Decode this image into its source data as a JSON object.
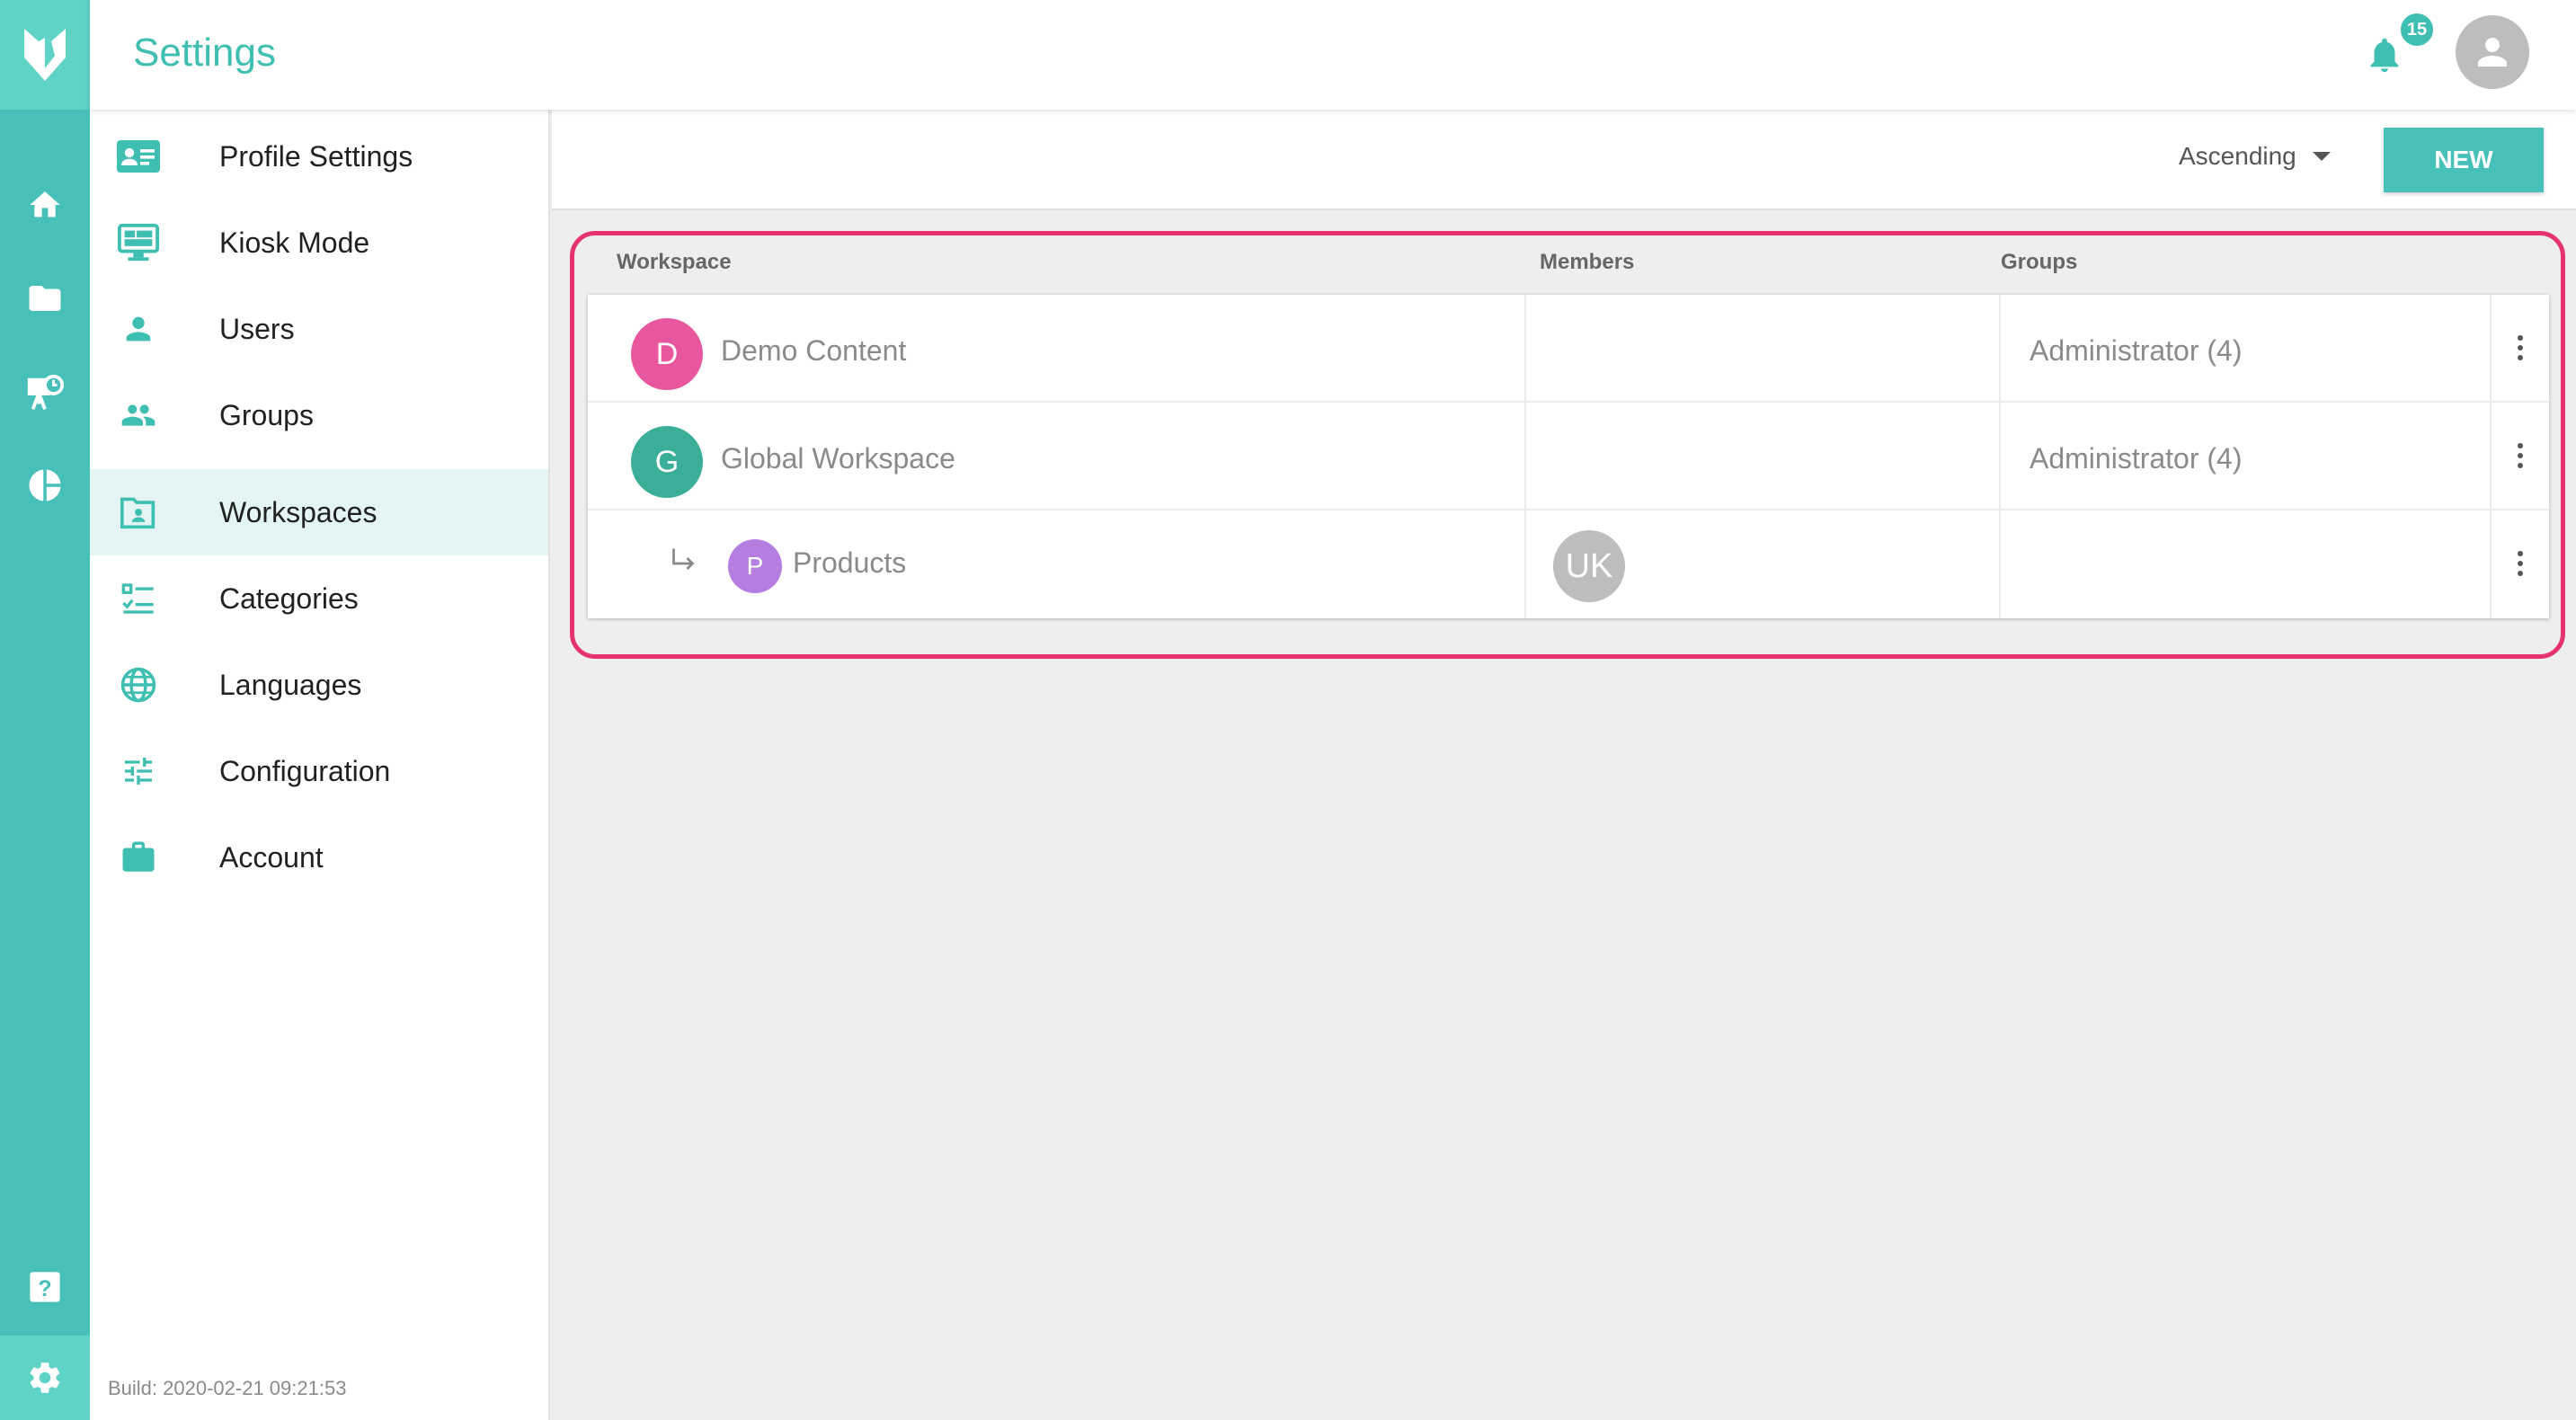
{
  "header": {
    "title": "Settings",
    "notification_count": "15"
  },
  "rail": {
    "icons": [
      "logo-icon",
      "home-icon",
      "folder-icon",
      "presentation-icon",
      "pie-chart-icon",
      "help-icon",
      "gear-icon"
    ]
  },
  "menu": {
    "items": [
      {
        "label": "Profile Settings",
        "icon": "id-card-icon"
      },
      {
        "label": "Kiosk Mode",
        "icon": "monitor-icon"
      },
      {
        "label": "Users",
        "icon": "person-icon"
      },
      {
        "label": "Groups",
        "icon": "people-icon"
      },
      {
        "label": "Workspaces",
        "icon": "folder-shared-icon",
        "active": true
      },
      {
        "label": "Categories",
        "icon": "checklist-icon"
      },
      {
        "label": "Languages",
        "icon": "globe-icon"
      },
      {
        "label": "Configuration",
        "icon": "sliders-icon"
      },
      {
        "label": "Account",
        "icon": "briefcase-icon"
      }
    ],
    "build": "Build: 2020-02-21 09:21:53"
  },
  "toolbar": {
    "sort_label": "Ascending",
    "new_label": "NEW"
  },
  "table": {
    "columns": [
      "Workspace",
      "Members",
      "Groups"
    ],
    "rows": [
      {
        "initial": "D",
        "name": "Demo Content",
        "color": "#e8579e",
        "members": "",
        "groups": "Administrator (4)"
      },
      {
        "initial": "G",
        "name": "Global Workspace",
        "color": "#3bae98",
        "members": "",
        "groups": "Administrator (4)"
      },
      {
        "initial": "P",
        "name": "Products",
        "color": "#b67ee0",
        "members": "UK",
        "groups": "",
        "child": true
      }
    ]
  },
  "colors": {
    "accent": "#46c0b8",
    "highlight": "#e6336f"
  }
}
